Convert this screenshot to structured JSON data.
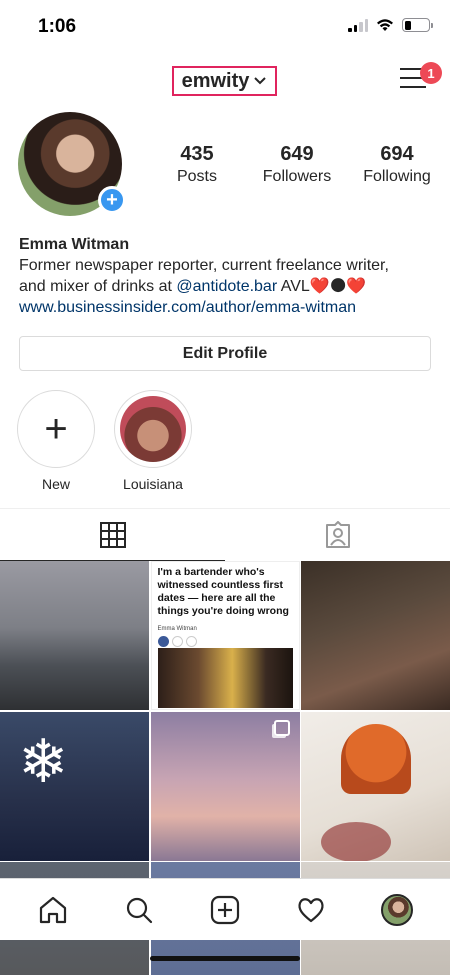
{
  "status_bar": {
    "time": "1:06",
    "icons": [
      "cellular-signal-icon",
      "wifi-icon",
      "battery-icon"
    ]
  },
  "header": {
    "username": "emwity",
    "menu_badge_count": "1",
    "highlight_color": "#e0245e"
  },
  "profile": {
    "stats": [
      {
        "value": "435",
        "label": "Posts"
      },
      {
        "value": "649",
        "label": "Followers"
      },
      {
        "value": "694",
        "label": "Following"
      }
    ],
    "bio": {
      "name": "Emma Witman",
      "line1": "Former newspaper reporter, current freelance writer,",
      "line2_prefix": "and mixer of drinks at ",
      "mention": "@antidote.bar",
      "line2_suffix": "  AVL❤️🌑❤️",
      "website": "www.businessinsider.com/author/emma-witman"
    },
    "edit_profile_label": "Edit Profile"
  },
  "highlights": [
    {
      "label": "New"
    },
    {
      "label": "Louisiana"
    }
  ],
  "tabs": [
    "grid-tab",
    "tagged-tab"
  ],
  "grid_posts": {
    "article": {
      "title": "I'm a bartender who's witnessed countless first dates — here are all the things you're doing wrong",
      "author": "Emma Witman"
    }
  },
  "bottom_nav": [
    "home-icon",
    "search-icon",
    "new-post-icon",
    "activity-heart-icon",
    "profile-avatar"
  ],
  "colors": {
    "accent_blue": "#3897f0",
    "badge_red": "#ed4956",
    "link_blue": "#003569",
    "border_gray": "#dbdbdb"
  }
}
